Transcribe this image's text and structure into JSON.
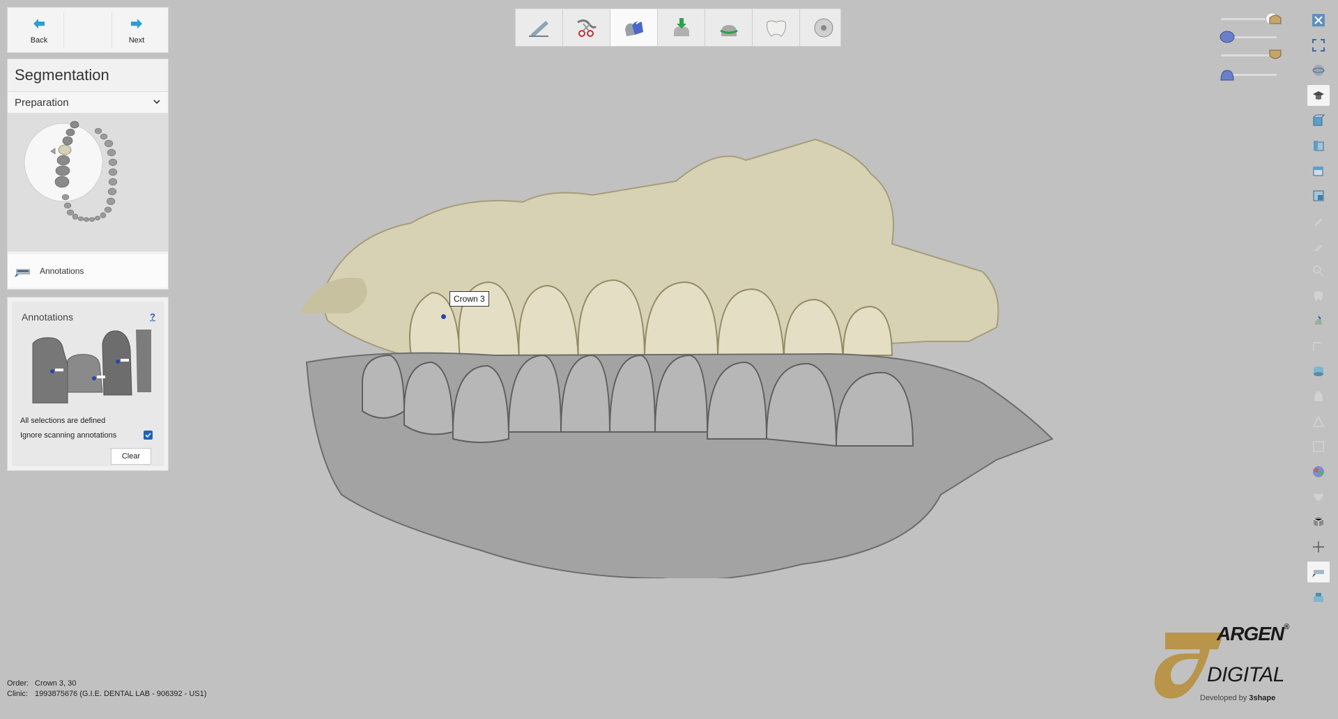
{
  "nav": {
    "back_label": "Back",
    "next_label": "Next"
  },
  "segmentation": {
    "title": "Segmentation",
    "section": "Preparation",
    "annotations_row_label": "Annotations"
  },
  "annotations": {
    "title": "Annotations",
    "help": "?",
    "status": "All selections are defined",
    "ignore_label": "Ignore scanning annotations",
    "ignore_checked": true,
    "clear_label": "Clear"
  },
  "toolbar": {
    "tools": [
      "scan-tool-icon",
      "trim-tool-icon",
      "segmentation-tool-icon",
      "download-tool-icon",
      "margin-tool-icon",
      "crown-tool-icon",
      "disc-tool-icon"
    ],
    "active_index": 2
  },
  "viewport": {
    "tooltip": "Crown 3",
    "upper_color": "#d8d2b4",
    "lower_color": "#9a9a9a"
  },
  "sliders": [
    {
      "name": "upper-jaw-opacity",
      "level": 1.0,
      "icon": "upper-jaw-icon"
    },
    {
      "name": "preparation-opacity",
      "level": 0.0,
      "icon": "prep-icon"
    },
    {
      "name": "antagonist-opacity",
      "level": 1.0,
      "icon": "antagonist-icon"
    },
    {
      "name": "gingiva-opacity",
      "level": 0.0,
      "icon": "gingiva-icon"
    }
  ],
  "order": {
    "order_key": "Order:",
    "order_value": "Crown 3, 30",
    "clinic_key": "Clinic:",
    "clinic_value": "1993875676 (G.I.E. DENTAL LAB - 906392 - US1)"
  },
  "logo": {
    "brand": "ARGEN",
    "reg": "®",
    "sub": "DIGITAL",
    "dev_prefix": "Developed by ",
    "dev_brand": "3shape"
  },
  "colors": {
    "background": "#c1c1c1",
    "accent": "#1e63b8",
    "logo_gold": "#b8954a"
  }
}
